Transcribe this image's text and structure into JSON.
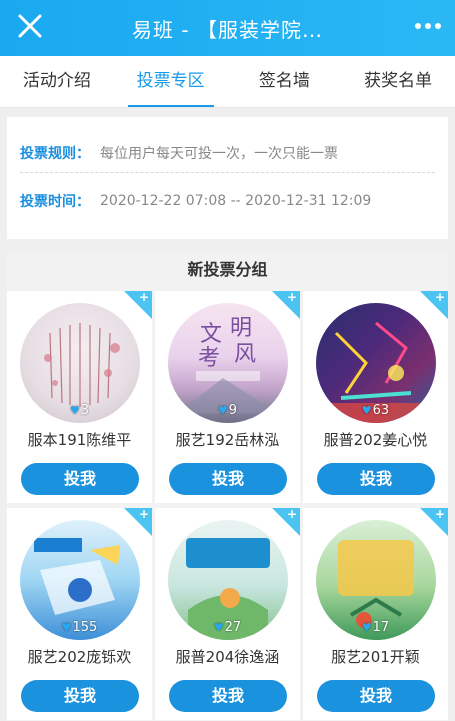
{
  "header": {
    "title": "易班 - 【服装学院…",
    "close_icon": "close-icon",
    "more_icon": "more-dots-icon"
  },
  "tabs": [
    {
      "label": "活动介绍",
      "active": false
    },
    {
      "label": "投票专区",
      "active": true
    },
    {
      "label": "签名墙",
      "active": false
    },
    {
      "label": "获奖名单",
      "active": false
    }
  ],
  "info": {
    "rule_label": "投票规则：",
    "rule_text": "每位用户每天可投一次，一次只能一票",
    "time_label": "投票时间：",
    "time_text": "2020-12-22 07:08 -- 2020-12-31 12:09"
  },
  "group": {
    "title": "新投票分组",
    "entries": [
      {
        "name": "服本191陈维平",
        "votes": "3",
        "vote_label": "投我",
        "plus": "+"
      },
      {
        "name": "服艺192岳林泓",
        "votes": "9",
        "vote_label": "投我",
        "plus": "+"
      },
      {
        "name": "服普202姜心悦",
        "votes": "63",
        "vote_label": "投我",
        "plus": "+"
      },
      {
        "name": "服艺202庞铄欢",
        "votes": "155",
        "vote_label": "投我",
        "plus": "+"
      },
      {
        "name": "服普204徐逸涵",
        "votes": "27",
        "vote_label": "投我",
        "plus": "+"
      },
      {
        "name": "服艺201开颖",
        "votes": "17",
        "vote_label": "投我",
        "plus": "+"
      }
    ]
  },
  "colors": {
    "header": "#1aa8f0",
    "accent": "#1a9ae8",
    "button": "#1a92de"
  }
}
